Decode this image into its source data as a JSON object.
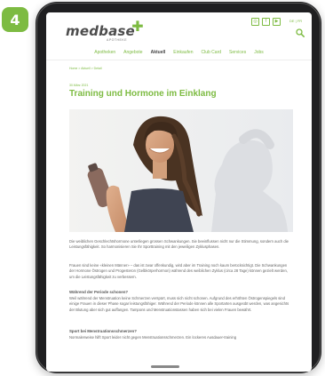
{
  "badge": {
    "number": "4"
  },
  "colors": {
    "brand_green": "#7dbb42",
    "frame": "#1f1f21"
  },
  "header": {
    "logo": "medbase",
    "logo_sub": "APOTHEKE",
    "social_icons": [
      "instagram-icon",
      "facebook-icon",
      "youtube-icon"
    ],
    "language": "DE | FR",
    "search_icon": "search-icon"
  },
  "nav": {
    "items": [
      "Apotheken",
      "Angebote",
      "Aktuell",
      "Einkaufen",
      "Club Card",
      "Services",
      "Jobs"
    ],
    "active": "Aktuell"
  },
  "breadcrumb": "Home  >  Aktuell  >  Detail",
  "article": {
    "date": "30.März 2021",
    "title": "Training und Hormone im Einklang",
    "paragraphs": [
      "Die weiblichen Geschlechtshormone unterliegen grossen Schwankungen. Sie beeinflussen nicht nur die Stimmung, sondern auch die Leistungsfähigkeit. So harmonisieren Sie Ihr Sporttraining mit den jeweiligen Zyklusphasen.",
      "Frauen sind keine «kleinen Männer» – das ist zwar offenkundig, wird aber im Training noch kaum berücksichtigt. Die Schwankungen der Hormone Östrogen und Progesteron (Gelbkörperhormon) während des weiblichen Zyklus (circa 28 Tage) können gezielt werden, um die Leistungsfähigkeit zu verbessern."
    ],
    "sections": [
      {
        "heading": "Während der Periode schonen?",
        "text": "Weil während der Menstruation keine Schmerzen verspürt, muss sich nicht schonen. Aufgrund des erhöhten Östrogenspiegels sind einige Frauen in dieser Phase sogar leistungsfähiger. Während der Periode können alle Sportarten ausgeübt werden, was angesichts der Blutung aber sich gut auffangen. Tampons und Menstruationstassen haben sich bei vielen Frauen bewährt."
      },
      {
        "heading": "Sport bei Menstruationsschmerzen?",
        "text": "Normalerweise hilft Sport leider nicht gegen Menstruationsschmerzen. Ein lockeres Ausdauer-training"
      }
    ]
  }
}
